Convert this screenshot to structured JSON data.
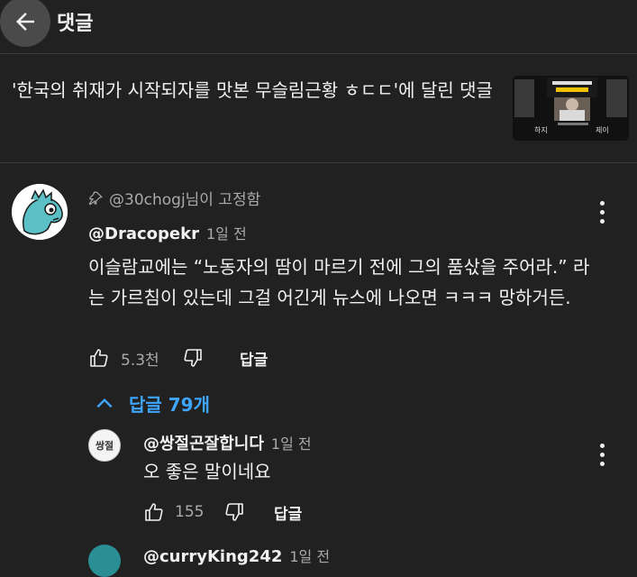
{
  "header": {
    "title": "댓글",
    "back_icon": "arrow-left-icon"
  },
  "video": {
    "title": "'한국의 취재가 시작되자를 맛본 무슬림근황 ㅎㄷㄷ'에 달린 댓글",
    "thumbnail": {
      "top_text": "한국의 '취재'가 시작되자를 맛본 무슬림근황",
      "left_caption": "하지",
      "right_caption": "제이"
    }
  },
  "comment": {
    "pinned_text": "@30chogj님이 고정함",
    "author": "@Dracopekr",
    "time": "1일 전",
    "text": "이슬람교에는 “노동자의 땀이 마르기 전에 그의 품삯을 주어라.” 라는 가르침이 있는데 그걸 어긴게 뉴스에 나오면 ㅋㅋㅋ 망하거든.",
    "likes": "5.3천",
    "reply_label": "답글"
  },
  "replies_toggle": {
    "label": "답글 79개"
  },
  "reply": {
    "author": "@쌍절곤잘합니다",
    "time": "1일 전",
    "text": "오 좋은 말이네요",
    "likes": "155",
    "reply_label": "답글",
    "avatar_text": "쌍절"
  },
  "next_reply": {
    "author": "@curryKing242",
    "time": "1일 전"
  },
  "colors": {
    "background": "#212121",
    "link": "#3ea6ff",
    "muted": "#aaaaaa",
    "avatar_teal": "#2a8f95"
  }
}
